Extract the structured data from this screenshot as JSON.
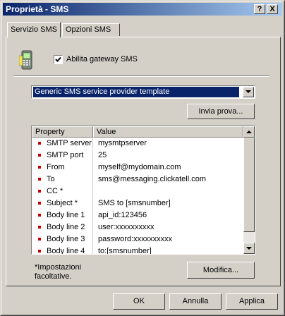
{
  "window": {
    "title": "Proprietà - SMS",
    "help_glyph": "?",
    "close_glyph": "X"
  },
  "tabs": [
    {
      "label": "Servizio SMS",
      "active": true
    },
    {
      "label": "Opzioni SMS",
      "active": false
    }
  ],
  "gateway": {
    "enable_label": "Abilita gateway SMS",
    "checked": true
  },
  "template_select": {
    "value": "Generic SMS service provider template"
  },
  "buttons": {
    "invia_prova": "Invia prova...",
    "modifica": "Modifica...",
    "ok": "OK",
    "annulla": "Annulla",
    "applica": "Applica"
  },
  "table": {
    "headers": [
      "Property",
      "Value"
    ],
    "rows": [
      {
        "property": "SMTP server",
        "value": "mysmtpserver"
      },
      {
        "property": "SMTP port",
        "value": "25"
      },
      {
        "property": "From",
        "value": "myself@mydomain.com"
      },
      {
        "property": "To",
        "value": "sms@messaging.clickatell.com"
      },
      {
        "property": "CC *",
        "value": ""
      },
      {
        "property": "Subject *",
        "value": "SMS to [smsnumber]"
      },
      {
        "property": "Body line 1",
        "value": "api_id:123456"
      },
      {
        "property": "Body line 2",
        "value": "user:xxxxxxxxxx"
      },
      {
        "property": "Body line 3",
        "value": "password:xxxxxxxxxx"
      },
      {
        "property": "Body line 4",
        "value": "to:[smsnumber]"
      }
    ]
  },
  "note": {
    "line1": "*Impostazioni",
    "line2": "facoltative."
  },
  "colors": {
    "face": "#d4d0c8",
    "title_active": "#0a246a",
    "selection": "#0a246a",
    "bullet": "#c00000"
  }
}
